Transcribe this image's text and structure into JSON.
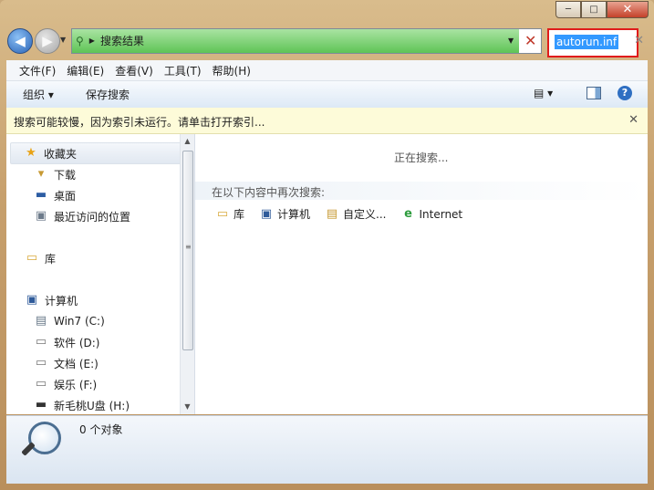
{
  "window": {
    "caption": {
      "min": "─",
      "max": "□",
      "close": "✕"
    }
  },
  "address": {
    "path_label": "搜索结果",
    "search_value": "autorun.inf",
    "search_clear": "✕"
  },
  "menu": {
    "items": [
      "文件(F)",
      "编辑(E)",
      "查看(V)",
      "工具(T)",
      "帮助(H)"
    ]
  },
  "toolbar": {
    "organize": "组织 ▾",
    "save_search": "保存搜索",
    "views": "▤ ▾",
    "help": "?"
  },
  "infobar": {
    "text": "搜索可能较慢，因为索引未运行。请单击打开索引...",
    "close": "✕"
  },
  "navpane": {
    "favorites": "收藏夹",
    "downloads": "下载",
    "desktop": "桌面",
    "recent": "最近访问的位置",
    "libraries": "库",
    "computer": "计算机",
    "drives": [
      "Win7 (C:)",
      "软件 (D:)",
      "文档 (E:)",
      "娱乐 (F:)",
      "新毛桃U盘 (H:)"
    ]
  },
  "content": {
    "searching": "正在搜索...",
    "research_label": "在以下内容中再次搜索:",
    "research_items": [
      "库",
      "计算机",
      "自定义...",
      "Internet"
    ]
  },
  "status": {
    "text": "0 个对象"
  },
  "colors": {
    "address_progress": "#5fc456",
    "highlight_border": "#e01b1b",
    "selection": "#3399ff"
  }
}
